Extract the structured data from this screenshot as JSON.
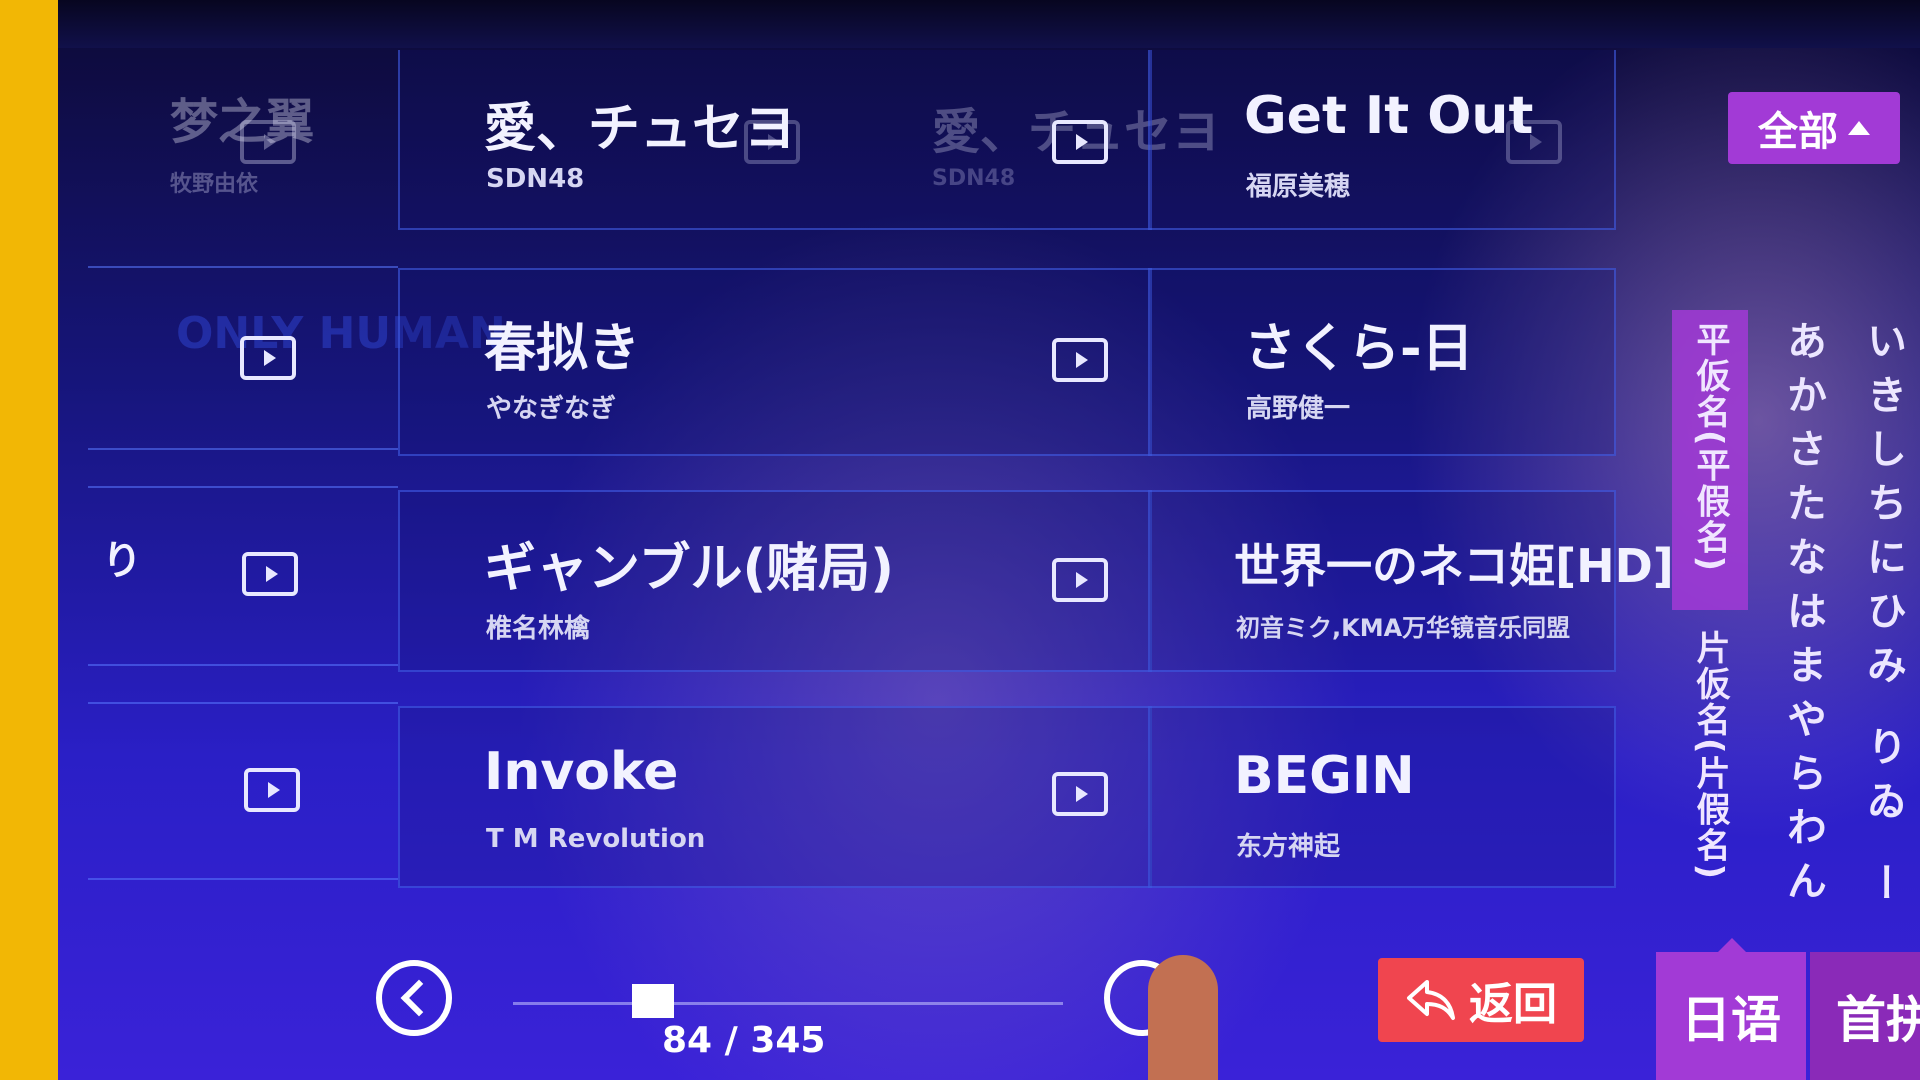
{
  "songs": [
    {
      "title": "愛、チュセヨ",
      "artist": "SDN48"
    },
    {
      "title": "Get It Out",
      "artist": "福原美穂"
    },
    {
      "title": "春拟き",
      "artist": "やなぎなぎ"
    },
    {
      "title": "さくら-日",
      "artist": "高野健一"
    },
    {
      "title": "ギャンブル(赌局)",
      "artist": "椎名林檎"
    },
    {
      "title": "世界一のネコ姫[HD]",
      "artist": "初音ミク,KMA万华镜音乐同盟"
    },
    {
      "title": "Invoke",
      "artist": "T M Revolution"
    },
    {
      "title": "BEGIN",
      "artist": "东方神起"
    }
  ],
  "ghost": {
    "left_title": "梦之翼",
    "left_artist": "牧野由依",
    "only_human": "ONLY HUMAN",
    "edge_char": "り",
    "reflect_title": "愛、チュセヨ",
    "reflect_artist": "SDN48"
  },
  "filter": {
    "all_label": "全部"
  },
  "kana_tabs": {
    "hiragana": "平仮名(平假名)",
    "katakana": "片仮名(片假名)"
  },
  "kana_columns": [
    "あかさたなはまやらわん",
    "いきしちにひみ りゐ ー"
  ],
  "pagination": {
    "current": 84,
    "total": 345,
    "text": "84 / 345"
  },
  "back_label": "返回",
  "bottom_tabs": {
    "japanese": "日语",
    "first": "首拼"
  },
  "colors": {
    "accent": "#a23ad6",
    "back": "#f0454f",
    "screen_bg": "#2a1fc6"
  }
}
